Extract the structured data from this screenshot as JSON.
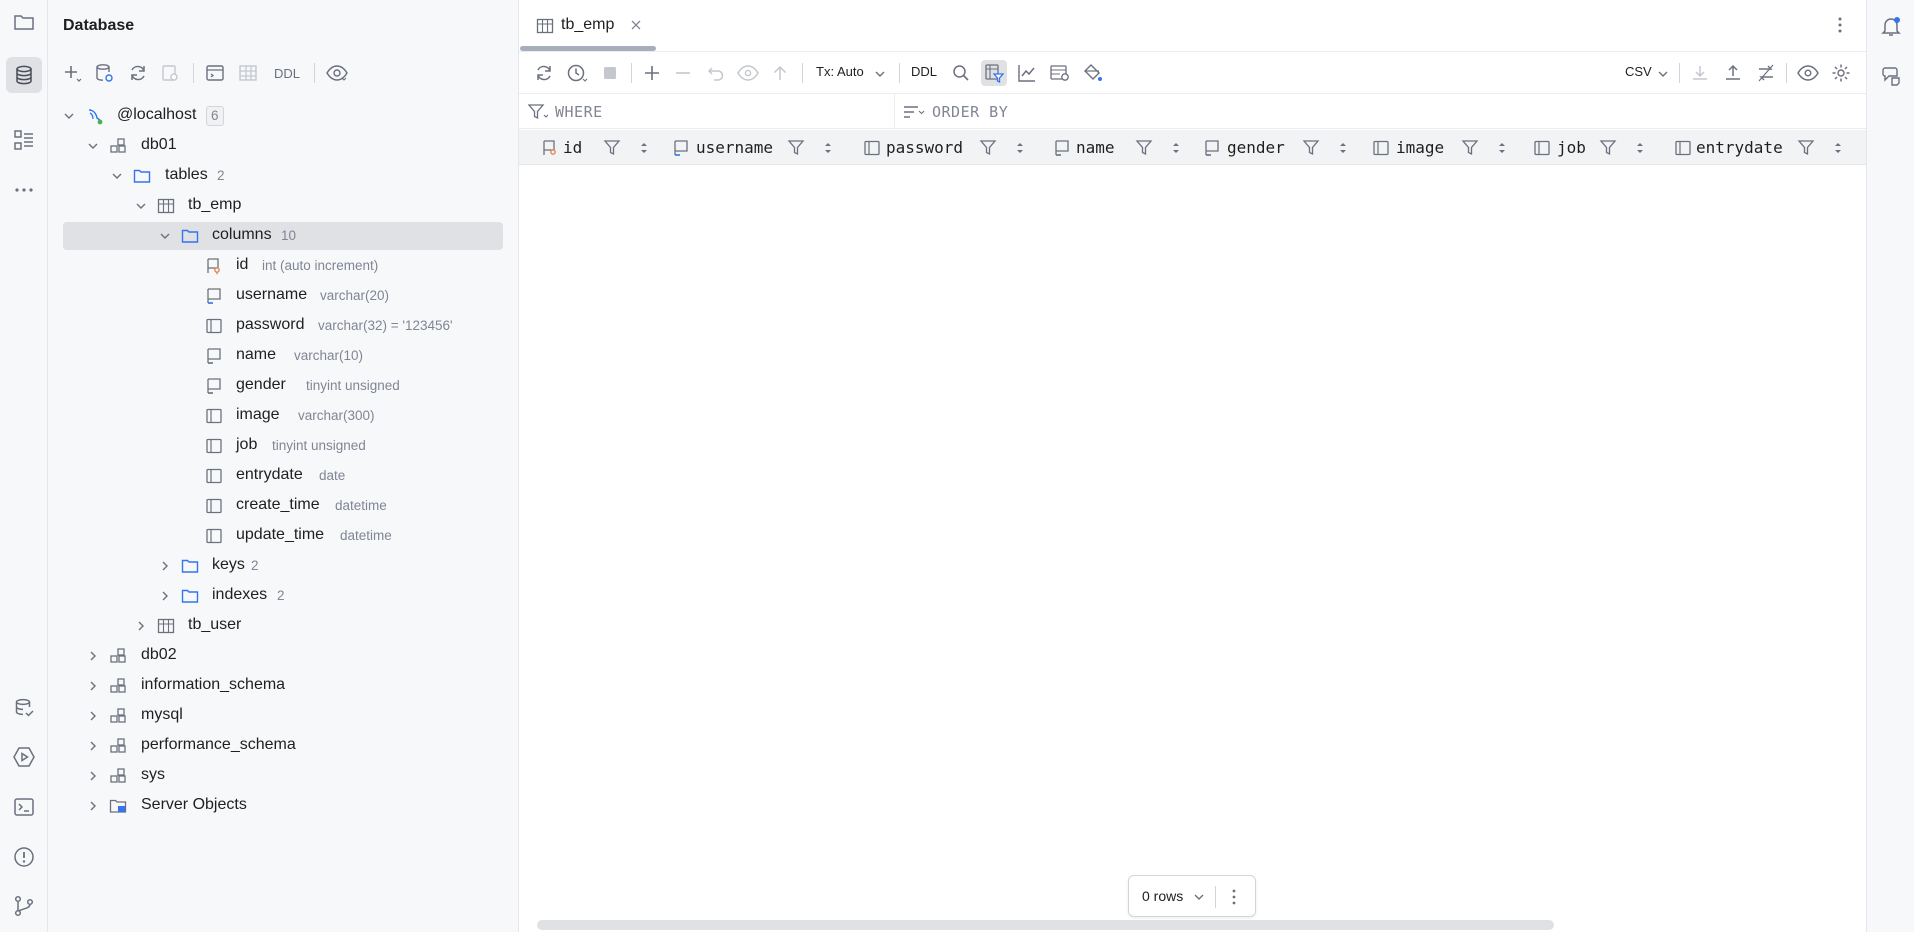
{
  "panel": {
    "title": "Database",
    "toolbar": {
      "ddl": "DDL"
    }
  },
  "tree": {
    "host": {
      "label": "@localhost",
      "count": "6"
    },
    "db01": {
      "label": "db01"
    },
    "tables": {
      "label": "tables",
      "count": "2"
    },
    "tb_emp": {
      "label": "tb_emp"
    },
    "columns": {
      "label": "columns",
      "count": "10"
    },
    "cols": [
      {
        "name": "id",
        "type": "int (auto increment)"
      },
      {
        "name": "username",
        "type": "varchar(20)"
      },
      {
        "name": "password",
        "type": "varchar(32) = '123456'"
      },
      {
        "name": "name",
        "type": "varchar(10)"
      },
      {
        "name": "gender",
        "type": "tinyint unsigned"
      },
      {
        "name": "image",
        "type": "varchar(300)"
      },
      {
        "name": "job",
        "type": "tinyint unsigned"
      },
      {
        "name": "entrydate",
        "type": "date"
      },
      {
        "name": "create_time",
        "type": "datetime"
      },
      {
        "name": "update_time",
        "type": "datetime"
      }
    ],
    "keys": {
      "label": "keys",
      "count": "2"
    },
    "indexes": {
      "label": "indexes",
      "count": "2"
    },
    "tb_user": {
      "label": "tb_user"
    },
    "schemas": [
      {
        "label": "db02"
      },
      {
        "label": "information_schema"
      },
      {
        "label": "mysql"
      },
      {
        "label": "performance_schema"
      },
      {
        "label": "sys"
      }
    ],
    "server_objects": {
      "label": "Server Objects"
    }
  },
  "editor": {
    "tab": {
      "label": "tb_emp"
    },
    "toolbar": {
      "tx": "Tx: Auto",
      "ddl": "DDL",
      "format": "CSV"
    },
    "filter": {
      "where": "WHERE",
      "order_by": "ORDER BY"
    },
    "columns": [
      "id",
      "username",
      "password",
      "name",
      "gender",
      "image",
      "job",
      "entrydate"
    ],
    "rows_label": "0 rows"
  },
  "colors": {
    "accent": "#3574f0",
    "selection": "#dfe1e5",
    "icon": "#6c707e",
    "key": "#e08855"
  }
}
